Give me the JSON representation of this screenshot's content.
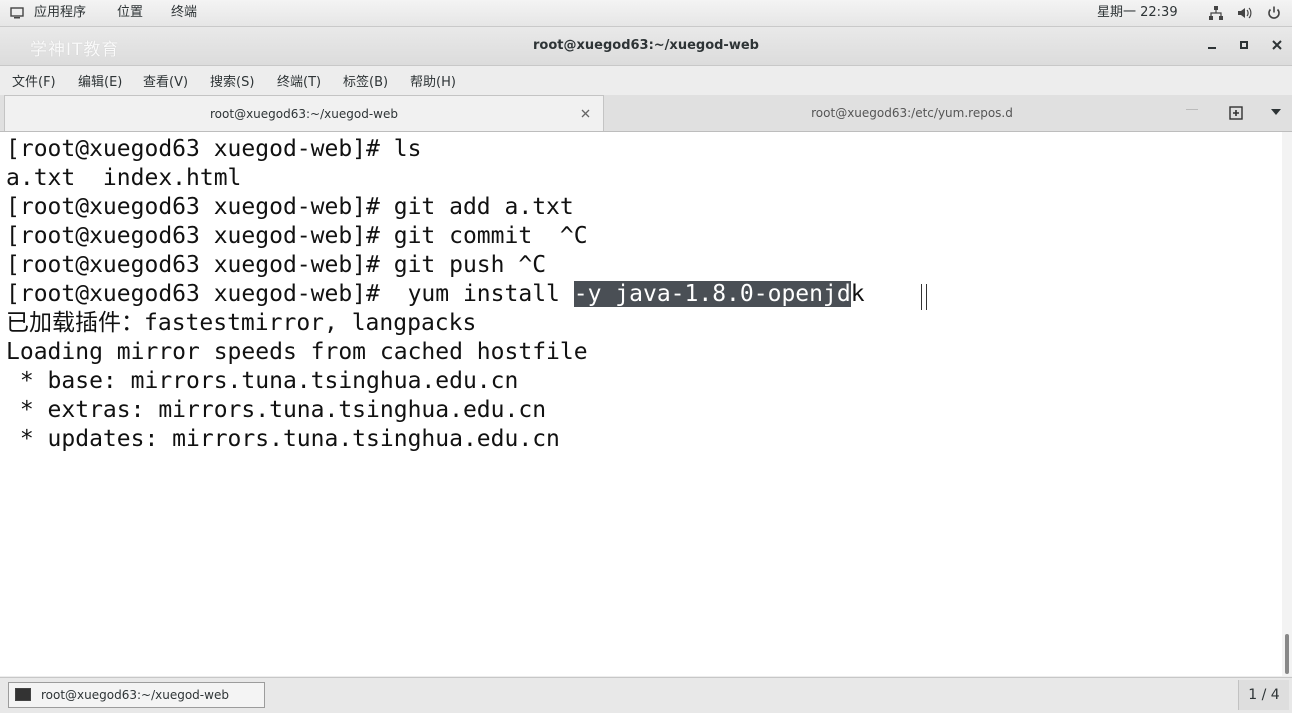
{
  "top_panel": {
    "applications": "应用程序",
    "places": "位置",
    "terminal": "终端",
    "clock": "星期一 22:39"
  },
  "titlebar": {
    "watermark": "学神IT教育",
    "title": "root@xuegod63:~/xuegod-web"
  },
  "menubar": {
    "file": "文件(F)",
    "edit": "编辑(E)",
    "view": "查看(V)",
    "search": "搜索(S)",
    "terminal": "终端(T)",
    "tabs": "标签(B)",
    "help": "帮助(H)"
  },
  "tabs": [
    {
      "label": "root@xuegod63:~/xuegod-web",
      "active": true
    },
    {
      "label": "root@xuegod63:/etc/yum.repos.d",
      "active": false
    }
  ],
  "terminal": {
    "lines": [
      "[root@xuegod63 xuegod-web]# ls",
      "a.txt  index.html",
      "[root@xuegod63 xuegod-web]# git add a.txt",
      "[root@xuegod63 xuegod-web]# git commit  ^C",
      "[root@xuegod63 xuegod-web]# git push ^C",
      "已加载插件：fastestmirror, langpacks",
      "Loading mirror speeds from cached hostfile",
      " * base: mirrors.tuna.tsinghua.edu.cn",
      " * extras: mirrors.tuna.tsinghua.edu.cn",
      " * updates: mirrors.tuna.tsinghua.edu.cn"
    ],
    "yum_prefix": "[root@xuegod63 xuegod-web]#  yum install ",
    "yum_selected": "-y java-1.8.0-openjd",
    "yum_suffix": "k"
  },
  "taskbar": {
    "window_label": "root@xuegod63:~/xuegod-web",
    "workspace": "1 / 4"
  },
  "colors": {
    "selection_bg": "#4a4f55",
    "terminal_bg": "#ffffff",
    "terminal_fg": "#111111"
  }
}
